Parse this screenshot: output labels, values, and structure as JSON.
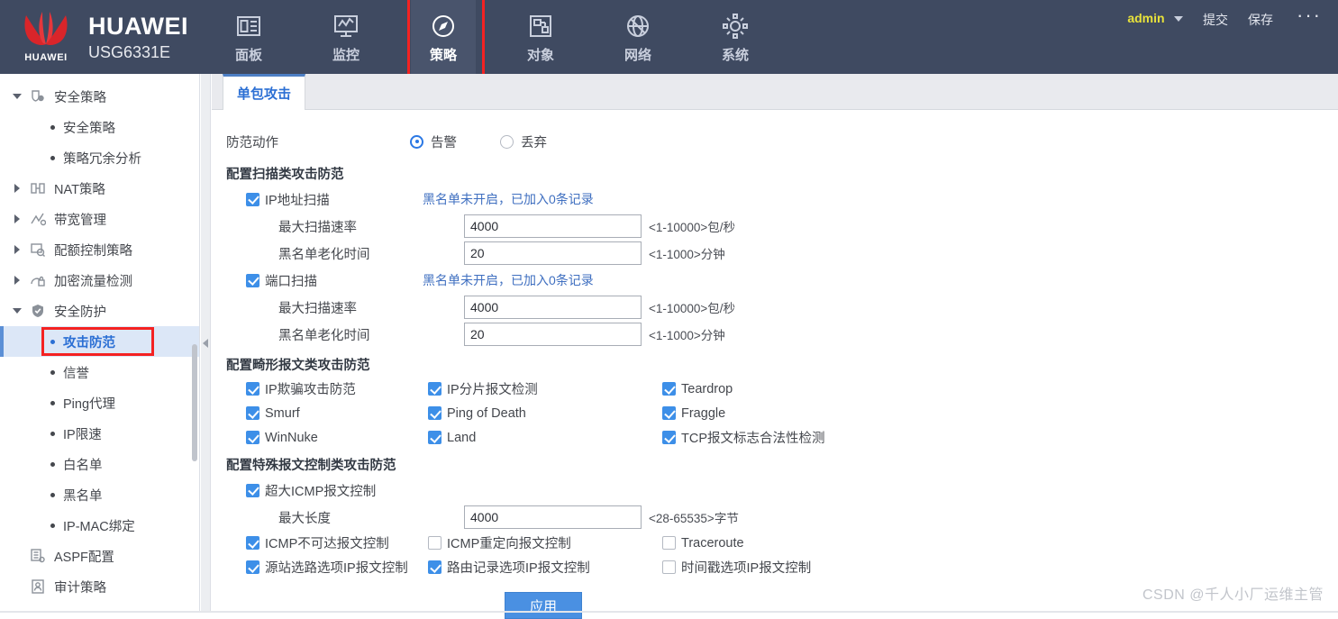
{
  "header": {
    "brand_name": "HUAWEI",
    "brand_model": "USG6331E",
    "nav": [
      {
        "label": "面板",
        "icon": "panel-icon",
        "active": false
      },
      {
        "label": "监控",
        "icon": "monitor-icon",
        "active": false
      },
      {
        "label": "策略",
        "icon": "compass-icon",
        "active": true
      },
      {
        "label": "对象",
        "icon": "object-icon",
        "active": false
      },
      {
        "label": "网络",
        "icon": "globe-icon",
        "active": false
      },
      {
        "label": "系统",
        "icon": "gear-icon",
        "active": false
      }
    ],
    "user": "admin",
    "submit_label": "提交",
    "save_label": "保存",
    "more_label": "···"
  },
  "sidebar": {
    "items": [
      {
        "label": "安全策略",
        "level": 1,
        "twisty": "down",
        "icon": "shield-policy-icon",
        "selected": false
      },
      {
        "label": "安全策略",
        "level": 2,
        "twisty": "none",
        "icon": "bullet",
        "selected": false
      },
      {
        "label": "策略冗余分析",
        "level": 2,
        "twisty": "none",
        "icon": "bullet",
        "selected": false
      },
      {
        "label": "NAT策略",
        "level": 1,
        "twisty": "right",
        "icon": "nat-icon",
        "selected": false
      },
      {
        "label": "带宽管理",
        "level": 1,
        "twisty": "right",
        "icon": "bandwidth-icon",
        "selected": false
      },
      {
        "label": "配额控制策略",
        "level": 1,
        "twisty": "right",
        "icon": "quota-icon",
        "selected": false
      },
      {
        "label": "加密流量检测",
        "level": 1,
        "twisty": "right",
        "icon": "encrypt-icon",
        "selected": false
      },
      {
        "label": "安全防护",
        "level": 1,
        "twisty": "down",
        "icon": "shield-check-icon",
        "selected": false
      },
      {
        "label": "攻击防范",
        "level": 2,
        "twisty": "none",
        "icon": "bullet",
        "selected": true
      },
      {
        "label": "信誉",
        "level": 2,
        "twisty": "none",
        "icon": "bullet",
        "selected": false
      },
      {
        "label": "Ping代理",
        "level": 2,
        "twisty": "none",
        "icon": "bullet",
        "selected": false
      },
      {
        "label": "IP限速",
        "level": 2,
        "twisty": "none",
        "icon": "bullet",
        "selected": false
      },
      {
        "label": "白名单",
        "level": 2,
        "twisty": "none",
        "icon": "bullet",
        "selected": false
      },
      {
        "label": "黑名单",
        "level": 2,
        "twisty": "none",
        "icon": "bullet",
        "selected": false
      },
      {
        "label": "IP-MAC绑定",
        "level": 2,
        "twisty": "none",
        "icon": "bullet",
        "selected": false
      },
      {
        "label": "ASPF配置",
        "level": 1,
        "twisty": "none",
        "icon": "aspf-icon",
        "selected": false
      },
      {
        "label": "审计策略",
        "level": 1,
        "twisty": "none",
        "icon": "audit-icon",
        "selected": false
      }
    ]
  },
  "main": {
    "tab_label": "单包攻击",
    "action_row": {
      "label": "防范动作",
      "options": [
        {
          "label": "告警",
          "selected": true
        },
        {
          "label": "丢弃",
          "selected": false
        }
      ]
    },
    "scan_section": {
      "title": "配置扫描类攻击防范",
      "blocks": [
        {
          "checkbox_label": "IP地址扫描",
          "checked": true,
          "note": "黑名单未开启，已加入0条记录",
          "fields": [
            {
              "label": "最大扫描速率",
              "value": "4000",
              "hint": "<1-10000>包/秒"
            },
            {
              "label": "黑名单老化时间",
              "value": "20",
              "hint": "<1-1000>分钟"
            }
          ]
        },
        {
          "checkbox_label": "端口扫描",
          "checked": true,
          "note": "黑名单未开启，已加入0条记录",
          "fields": [
            {
              "label": "最大扫描速率",
              "value": "4000",
              "hint": "<1-10000>包/秒"
            },
            {
              "label": "黑名单老化时间",
              "value": "20",
              "hint": "<1-1000>分钟"
            }
          ]
        }
      ]
    },
    "malformed_section": {
      "title": "配置畸形报文类攻击防范",
      "rows": [
        [
          {
            "label": "IP欺骗攻击防范",
            "checked": true
          },
          {
            "label": "IP分片报文检测",
            "checked": true
          },
          {
            "label": "Teardrop",
            "checked": true
          }
        ],
        [
          {
            "label": "Smurf",
            "checked": true
          },
          {
            "label": "Ping of Death",
            "checked": true
          },
          {
            "label": "Fraggle",
            "checked": true
          }
        ],
        [
          {
            "label": "WinNuke",
            "checked": true
          },
          {
            "label": "Land",
            "checked": true
          },
          {
            "label": "TCP报文标志合法性检测",
            "checked": true
          }
        ]
      ]
    },
    "special_section": {
      "title": "配置特殊报文控制类攻击防范",
      "icmp_big": {
        "label": "超大ICMP报文控制",
        "checked": true
      },
      "max_len": {
        "label": "最大长度",
        "value": "4000",
        "hint": "<28-65535>字节"
      },
      "rows": [
        [
          {
            "label": "ICMP不可达报文控制",
            "checked": true
          },
          {
            "label": "ICMP重定向报文控制",
            "checked": false
          },
          {
            "label": "Traceroute",
            "checked": false
          }
        ],
        [
          {
            "label": "源站选路选项IP报文控制",
            "checked": true
          },
          {
            "label": "路由记录选项IP报文控制",
            "checked": true
          },
          {
            "label": "时间戳选项IP报文控制",
            "checked": false
          }
        ]
      ]
    },
    "apply_label": "应用"
  },
  "watermark": "CSDN @千人小厂运维主管",
  "colors": {
    "header_bg": "#3f4a61",
    "accent_blue": "#2b6fd4",
    "checkbox_blue": "#3d8fe8",
    "button_blue": "#4a90e2",
    "highlight_red": "#f42222",
    "user_yellow": "#e8e23a",
    "selected_row_bg": "#dce7f7"
  }
}
